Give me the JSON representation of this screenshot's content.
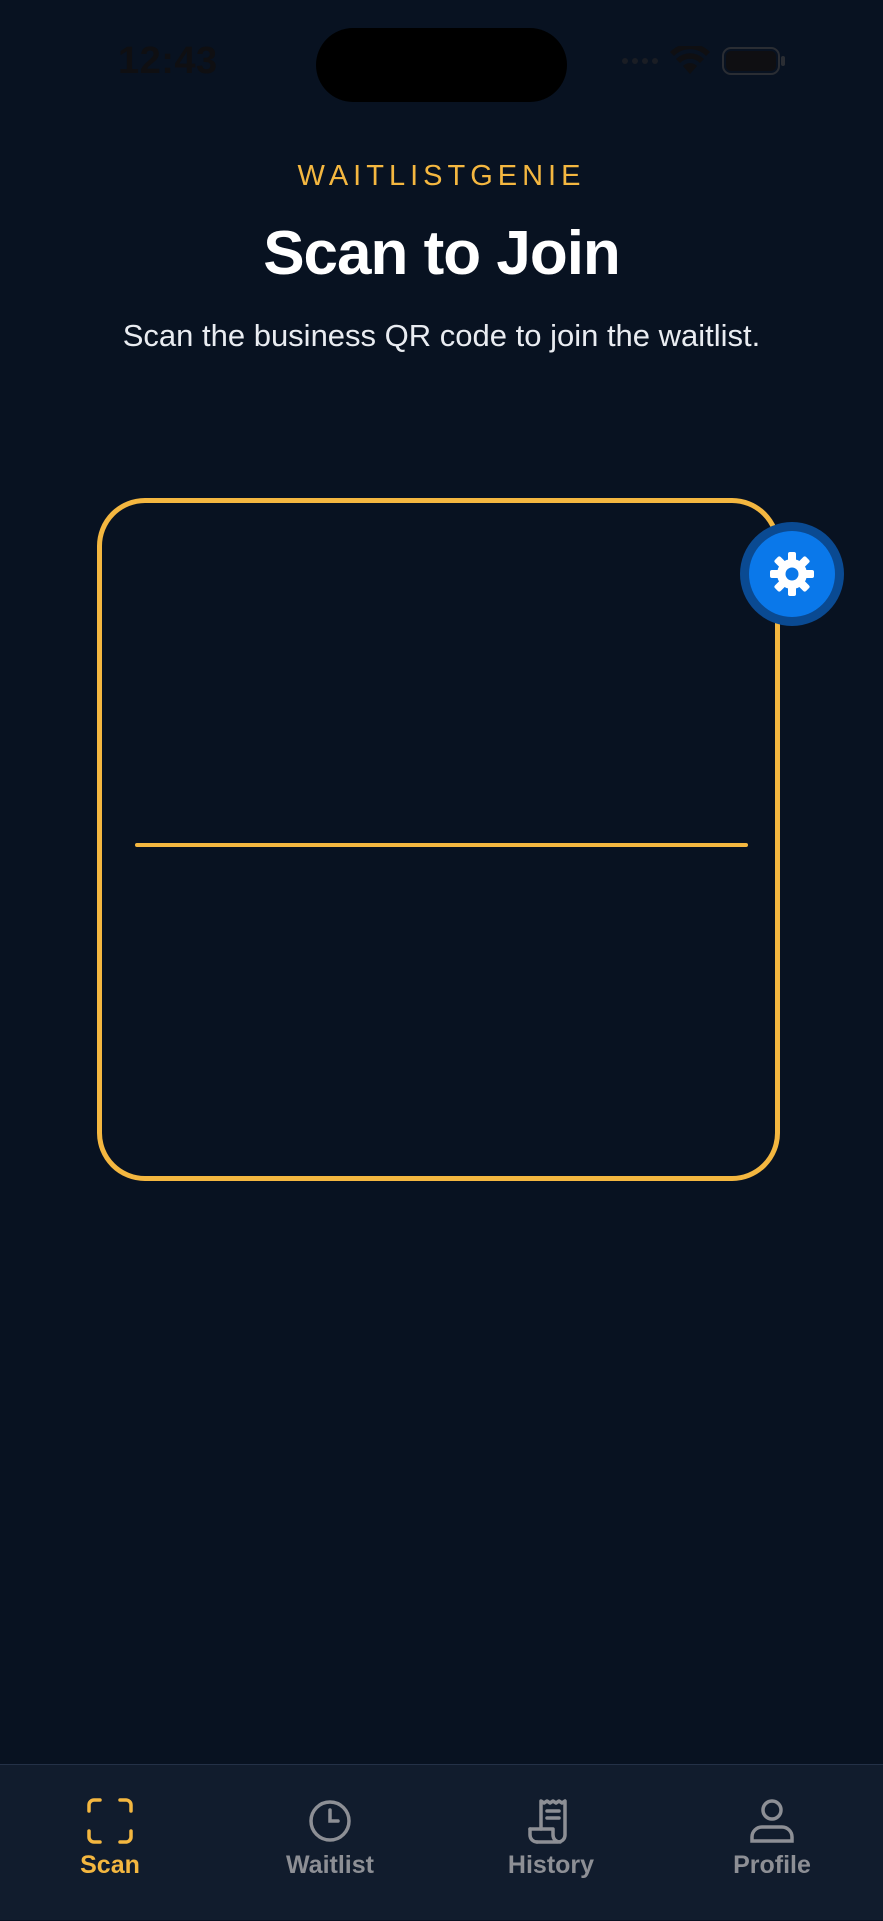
{
  "status_bar": {
    "time": "12:43"
  },
  "header": {
    "brand": "WAITLISTGENIE",
    "title": "Scan to Join",
    "subtitle": "Scan the business QR code to join the waitlist."
  },
  "scanner": {
    "settings_icon": "gear-icon"
  },
  "tab_bar": {
    "tabs": [
      {
        "label": "Scan",
        "icon": "scan-icon",
        "active": true
      },
      {
        "label": "Waitlist",
        "icon": "clock-icon",
        "active": false
      },
      {
        "label": "History",
        "icon": "receipt-icon",
        "active": false
      },
      {
        "label": "Profile",
        "icon": "person-icon",
        "active": false
      }
    ]
  },
  "colors": {
    "background": "#081221",
    "accent": "#f4b740",
    "fab_blue": "#0a78ea",
    "tab_bar_bg": "#111c2d",
    "inactive_tab": "#8d8f95"
  }
}
